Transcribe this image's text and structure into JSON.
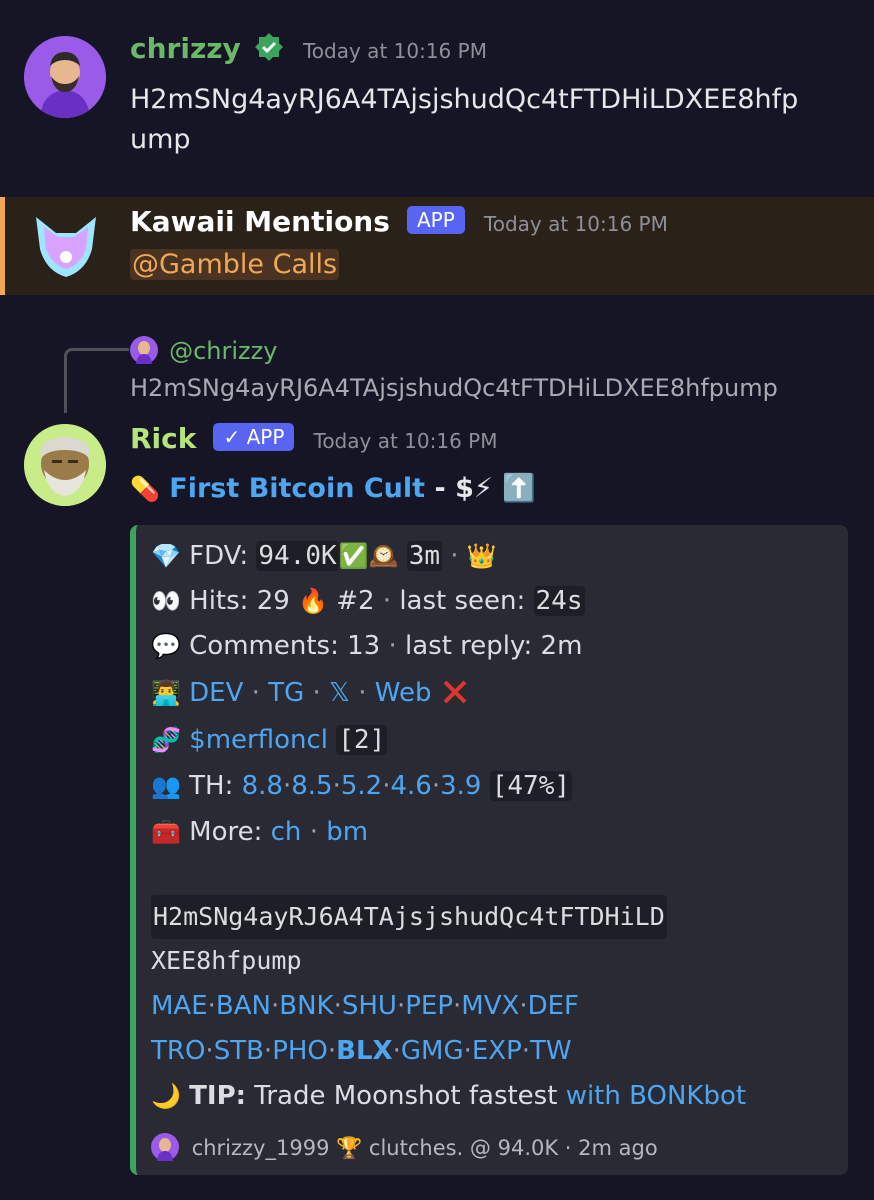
{
  "messages": {
    "m1": {
      "username": "chrizzy",
      "timestamp": "Today at 10:16 PM",
      "text_line1": "H2mSNg4ayRJ6A4TAjsjshudQc4tFTDHiLDXEE8hfp",
      "text_line2": "ump"
    },
    "m2": {
      "username": "Kawaii Mentions",
      "badge": "APP",
      "timestamp": "Today at 10:16 PM",
      "mention": "@Gamble Calls"
    },
    "m3": {
      "reply_user": "@chrizzy",
      "reply_text": "H2mSNg4ayRJ6A4TAjsjshudQc4tFTDHiLDXEE8hfpump",
      "username": "Rick",
      "badge": "✓ APP",
      "timestamp": "Today at 10:16 PM",
      "title_emoji": "💊",
      "title_link": "First Bitcoin Cult",
      "title_rest": " - $⚡ ⬆️"
    }
  },
  "embed": {
    "fdv_label": "FDV: ",
    "fdv_value": "94.0K",
    "fdv_age": "3m",
    "hits_label": "Hits: 29 ",
    "hits_rank": "#2",
    "last_seen_label": "last seen: ",
    "last_seen_value": "24s",
    "comments": "Comments: 13",
    "last_reply": "last reply: 2m",
    "links": [
      "DEV",
      "TG",
      "𝕏",
      "Web"
    ],
    "ticker": "$merfloncl",
    "ticker_count": "[2]",
    "th_label": "TH: ",
    "th_values": [
      "8.8",
      "8.5",
      "5.2",
      "4.6",
      "3.9"
    ],
    "th_pct": "[47%]",
    "more_label": "More: ",
    "more_links": [
      "ch",
      "bm"
    ],
    "ca_line1": "H2mSNg4ayRJ6A4TAjsjshudQc4tFTDHiLD",
    "ca_line2": "XEE8hfpump",
    "bots_row1": [
      "MAE",
      "BAN",
      "BNK",
      "SHU",
      "PEP",
      "MVX",
      "DEF"
    ],
    "bots_row2": [
      "TRO",
      "STB",
      "PHO",
      "BLX",
      "GMG",
      "EXP",
      "TW"
    ],
    "tip_label": "TIP:",
    "tip_text": " Trade Moonshot fastest ",
    "tip_link": "with BONKbot",
    "footer": "chrizzy_1999 🏆 clutches. @ 94.0K · 2m ago"
  },
  "colors": {
    "background": "#161525",
    "green_name": "#6bb86a",
    "rick_name": "#b3e57a",
    "link": "#4ea5f0",
    "embed_border": "#3ba55d",
    "app_badge": "#5865f2"
  }
}
